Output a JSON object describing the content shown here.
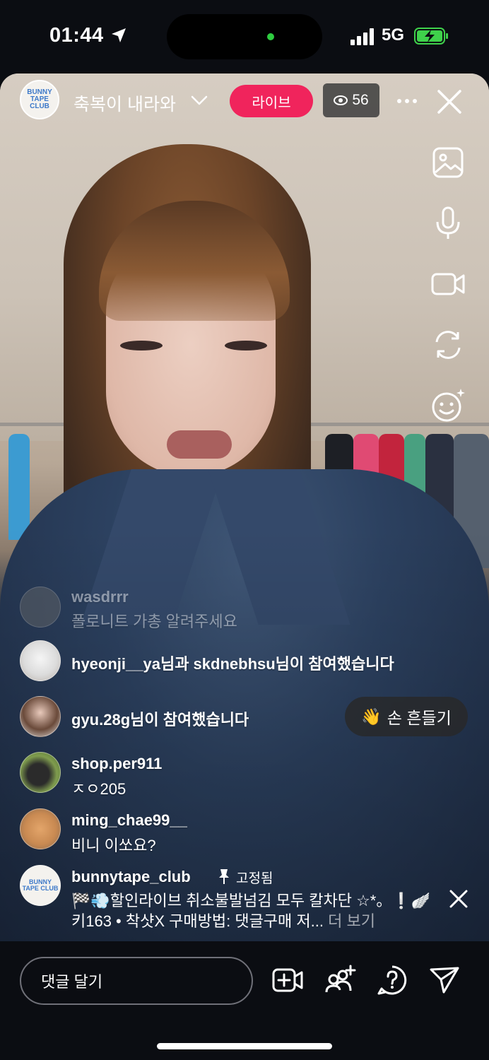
{
  "status_bar": {
    "time": "01:44",
    "network": "5G"
  },
  "live_header": {
    "host_name": "축복이 내라와",
    "host_avatar_text": "BUNNY TAPE CLUB",
    "live_label": "라이브",
    "viewer_count": "56"
  },
  "comments": [
    {
      "user": "wasdrrr",
      "text": "폴로니트 가총 알려주세요",
      "faded": true
    },
    {
      "user": "hyeonji__ya",
      "text": "님과 skdnebhsu님이 참여했습니다",
      "type": "join"
    },
    {
      "user": "gyu.28g",
      "text": "님이 참여했습니다",
      "type": "join"
    },
    {
      "user": "shop.per911",
      "text": "ㅈㅇ205"
    },
    {
      "user": "ming_chae99__",
      "text": "비니 이쏘요?"
    }
  ],
  "wave_button": {
    "emoji": "👋",
    "label": "손 흔들기"
  },
  "pinned_comment": {
    "user": "bunnytape_club",
    "pinned_label": "고정됨",
    "line1": "🏁💨할인라이브 취소불발넘김 모두 칼차단 ☆*。❕🪽",
    "line2": "키163 • 착샷X 구매방법: 댓글구매 저...",
    "see_more": "더 보기"
  },
  "input": {
    "placeholder": "댓글 달기"
  },
  "colors": {
    "live": "#f0245c",
    "background": "#0b0d12"
  },
  "icons": {
    "rail": [
      "image-icon",
      "microphone-icon",
      "video-camera-icon",
      "flip-camera-icon",
      "face-effects-icon"
    ],
    "bottom": [
      "add-video-icon",
      "invite-icon",
      "question-icon",
      "send-icon"
    ]
  }
}
